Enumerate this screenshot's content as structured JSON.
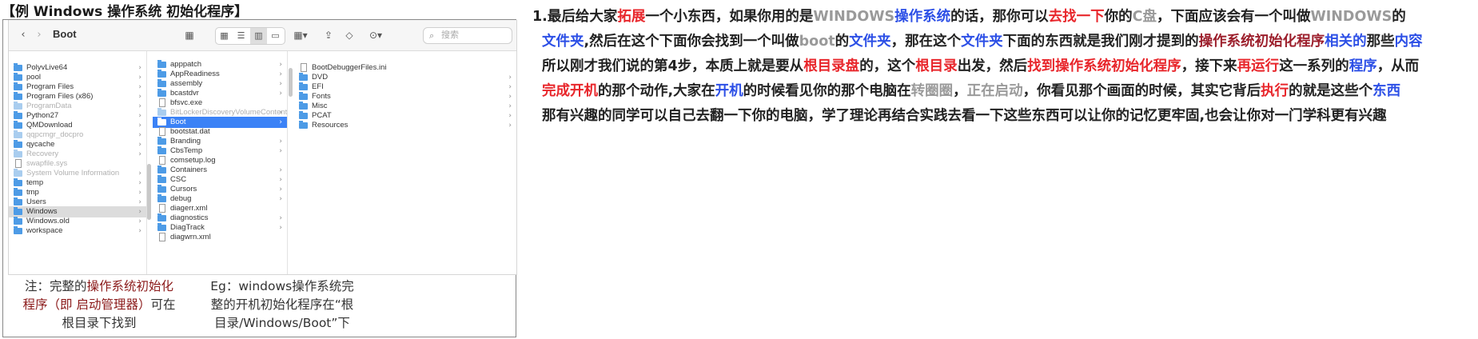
{
  "header": {
    "title": "【例 Windows 操作系统 初始化程序】"
  },
  "finder": {
    "title": "Boot",
    "search_placeholder": "搜索",
    "sidebar": [
      {
        "name": "PolyvLive64",
        "kind": "folder",
        "dim": false
      },
      {
        "name": "pool",
        "kind": "folder",
        "dim": false
      },
      {
        "name": "Program Files",
        "kind": "folder",
        "dim": false
      },
      {
        "name": "Program Files (x86)",
        "kind": "folder",
        "dim": false
      },
      {
        "name": "ProgramData",
        "kind": "folder",
        "dim": true
      },
      {
        "name": "Python27",
        "kind": "folder",
        "dim": false
      },
      {
        "name": "QMDownload",
        "kind": "folder",
        "dim": false
      },
      {
        "name": "qqpcmgr_docpro",
        "kind": "folder",
        "dim": true
      },
      {
        "name": "qycache",
        "kind": "folder",
        "dim": false
      },
      {
        "name": "Recovery",
        "kind": "folder",
        "dim": true
      },
      {
        "name": "swapfile.sys",
        "kind": "file",
        "dim": true
      },
      {
        "name": "System Volume Information",
        "kind": "folder",
        "dim": true
      },
      {
        "name": "temp",
        "kind": "folder",
        "dim": false
      },
      {
        "name": "tmp",
        "kind": "folder",
        "dim": false
      },
      {
        "name": "Users",
        "kind": "folder",
        "dim": false
      },
      {
        "name": "Windows",
        "kind": "folder",
        "dim": false,
        "selected": true
      },
      {
        "name": "Windows.old",
        "kind": "folder",
        "dim": false
      },
      {
        "name": "workspace",
        "kind": "folder",
        "dim": false
      }
    ],
    "middle": [
      {
        "name": "apppatch",
        "kind": "folder",
        "dim": false
      },
      {
        "name": "AppReadiness",
        "kind": "folder",
        "dim": false
      },
      {
        "name": "assembly",
        "kind": "folder",
        "dim": false
      },
      {
        "name": "bcastdvr",
        "kind": "folder",
        "dim": false
      },
      {
        "name": "bfsvc.exe",
        "kind": "file",
        "dim": false
      },
      {
        "name": "BitLockerDiscoveryVolumeContents",
        "kind": "folder",
        "dim": true
      },
      {
        "name": "Boot",
        "kind": "folder",
        "dim": false,
        "active": true
      },
      {
        "name": "bootstat.dat",
        "kind": "file",
        "dim": false
      },
      {
        "name": "Branding",
        "kind": "folder",
        "dim": false
      },
      {
        "name": "CbsTemp",
        "kind": "folder",
        "dim": false
      },
      {
        "name": "comsetup.log",
        "kind": "file",
        "dim": false
      },
      {
        "name": "Containers",
        "kind": "folder",
        "dim": false
      },
      {
        "name": "CSC",
        "kind": "folder",
        "dim": false
      },
      {
        "name": "Cursors",
        "kind": "folder",
        "dim": false
      },
      {
        "name": "debug",
        "kind": "folder",
        "dim": false
      },
      {
        "name": "diagerr.xml",
        "kind": "file",
        "dim": false
      },
      {
        "name": "diagnostics",
        "kind": "folder",
        "dim": false
      },
      {
        "name": "DiagTrack",
        "kind": "folder",
        "dim": false
      },
      {
        "name": "diagwrn.xml",
        "kind": "file",
        "dim": false
      }
    ],
    "right": [
      {
        "name": "BootDebuggerFiles.ini",
        "kind": "file",
        "dim": false
      },
      {
        "name": "DVD",
        "kind": "folder",
        "dim": false
      },
      {
        "name": "EFI",
        "kind": "folder",
        "dim": false
      },
      {
        "name": "Fonts",
        "kind": "folder",
        "dim": false
      },
      {
        "name": "Misc",
        "kind": "folder",
        "dim": false
      },
      {
        "name": "PCAT",
        "kind": "folder",
        "dim": false
      },
      {
        "name": "Resources",
        "kind": "folder",
        "dim": false
      }
    ]
  },
  "note1": {
    "a": "注：完整的",
    "b": "操作系统初始化程序（即 启动管理器）",
    "c": "可在根目录下找到"
  },
  "note2": {
    "text": "Eg：windows操作系统完整的开机初始化程序在“根目录/Windows/Boot”下"
  },
  "paragraph": [
    [
      {
        "t": "1.最后给大家",
        "c": ""
      },
      {
        "t": "拓展",
        "c": "red"
      },
      {
        "t": "一个小东西，如果你用的是",
        "c": ""
      },
      {
        "t": "WINDOWS",
        "c": "grey"
      },
      {
        "t": "操作系统",
        "c": "blue"
      },
      {
        "t": "的话，那你可以",
        "c": ""
      },
      {
        "t": "去找一下",
        "c": "red"
      },
      {
        "t": "你的",
        "c": ""
      },
      {
        "t": "C盘",
        "c": "grey"
      },
      {
        "t": "，下面应该会有一个叫做",
        "c": ""
      },
      {
        "t": "WINDOWS",
        "c": "grey"
      },
      {
        "t": "的",
        "c": ""
      }
    ],
    [
      {
        "t": "文件夹",
        "c": "blue"
      },
      {
        "t": ",然后在这个下面你会找到一个叫做",
        "c": ""
      },
      {
        "t": "boot",
        "c": "grey"
      },
      {
        "t": "的",
        "c": ""
      },
      {
        "t": "文件夹",
        "c": "blue"
      },
      {
        "t": "，那在这个",
        "c": ""
      },
      {
        "t": "文件夹",
        "c": "blue"
      },
      {
        "t": "下面的东西就是我们刚才提到的",
        "c": ""
      },
      {
        "t": "操作系统初始化程序",
        "c": "maroon"
      },
      {
        "t": "相关的",
        "c": "blue"
      },
      {
        "t": "那些",
        "c": ""
      },
      {
        "t": "内容",
        "c": "blue"
      }
    ],
    [
      {
        "t": "所以刚才我们说的第4步，本质上就是要从",
        "c": ""
      },
      {
        "t": "根目录盘",
        "c": "red"
      },
      {
        "t": "的，这个",
        "c": ""
      },
      {
        "t": "根目录",
        "c": "red"
      },
      {
        "t": "出发，然后",
        "c": ""
      },
      {
        "t": "找到操作系统初始化程序",
        "c": "red"
      },
      {
        "t": "，接下来",
        "c": ""
      },
      {
        "t": "再运行",
        "c": "red"
      },
      {
        "t": "这一系列的",
        "c": ""
      },
      {
        "t": "程序",
        "c": "blue"
      },
      {
        "t": "，从而",
        "c": ""
      }
    ],
    [
      {
        "t": "完成开机",
        "c": "red"
      },
      {
        "t": "的那个动作,大家在",
        "c": ""
      },
      {
        "t": "开机",
        "c": "blue"
      },
      {
        "t": "的时候看见你的那个电脑在",
        "c": ""
      },
      {
        "t": "转圈圈",
        "c": "grey"
      },
      {
        "t": "，",
        "c": ""
      },
      {
        "t": "正在启动",
        "c": "grey"
      },
      {
        "t": "，你看见那个画面的时候，其实它背后",
        "c": ""
      },
      {
        "t": "执行",
        "c": "red"
      },
      {
        "t": "的就是这些个",
        "c": ""
      },
      {
        "t": "东西",
        "c": "blue"
      }
    ],
    [
      {
        "t": "那有兴趣的同学可以自己去翻一下你的电脑，学了理论再结合实践去看一下这些东西可以让你的记忆更牢固,也会让你对一门学科更有兴趣",
        "c": ""
      }
    ]
  ]
}
